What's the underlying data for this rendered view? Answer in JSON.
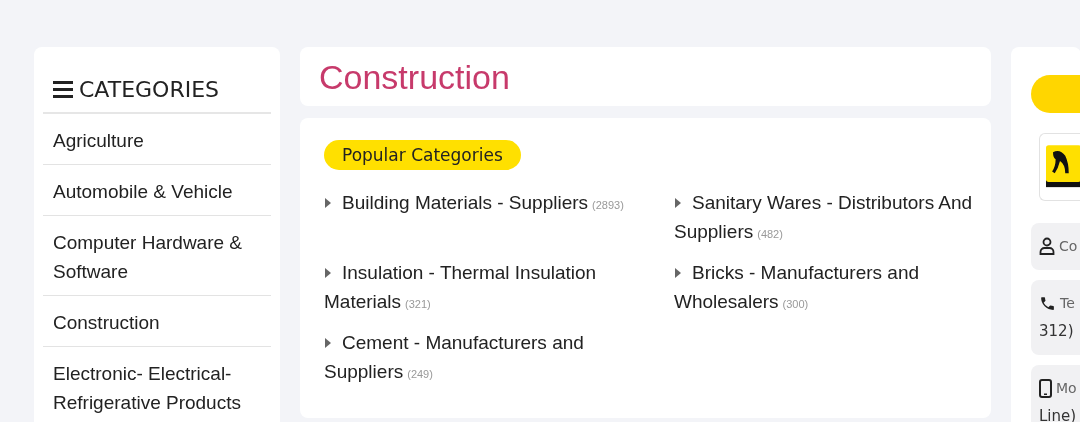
{
  "sidebar": {
    "title": "CATEGORIES",
    "items": [
      {
        "label": "Agriculture"
      },
      {
        "label": "Automobile & Vehicle"
      },
      {
        "label": "Computer Hardware & Software"
      },
      {
        "label": "Construction"
      },
      {
        "label": "Electronic- Electrical- Refrigerative Products"
      }
    ]
  },
  "page_title": "Construction",
  "popular": {
    "badge": "Popular Categories",
    "items": [
      {
        "label": "Building Materials - Suppliers",
        "count": "(2893)"
      },
      {
        "label": "Sanitary Wares - Distributors And Suppliers",
        "count": "(482)"
      },
      {
        "label": "Insulation - Thermal Insulation Materials",
        "count": "(321)"
      },
      {
        "label": "Bricks - Manufacturers and Wholesalers",
        "count": "(300)"
      },
      {
        "label": "Cement - Manufacturers and Suppliers",
        "count": "(249)"
      }
    ]
  },
  "contact": {
    "rows": [
      {
        "kind": "person",
        "lines": [
          "Co"
        ]
      },
      {
        "kind": "phone",
        "lines": [
          "Te",
          "312)"
        ]
      },
      {
        "kind": "mobile",
        "lines": [
          "Mo",
          "Line)"
        ]
      }
    ]
  }
}
